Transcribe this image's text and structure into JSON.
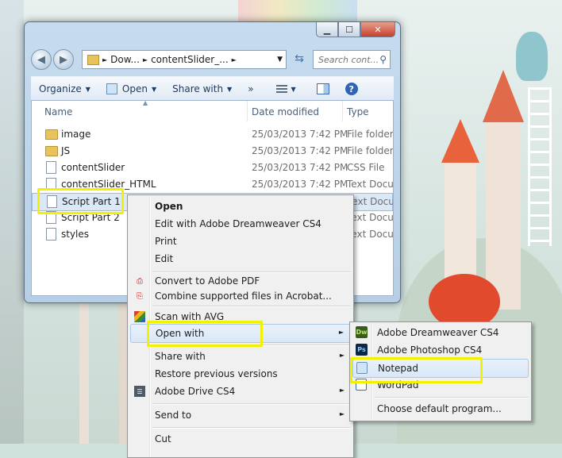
{
  "window": {
    "caption_min": "▁",
    "caption_max": "☐",
    "caption_close": "✕"
  },
  "address": {
    "segments": [
      "Dow...",
      "contentSlider_..."
    ],
    "separator": "►",
    "dropdown": "▼"
  },
  "search": {
    "placeholder": "Search cont..."
  },
  "toolbar": {
    "organize": "Organize",
    "open": "Open",
    "share_with": "Share with",
    "more": "»"
  },
  "columns": {
    "name": "Name",
    "date_modified": "Date modified",
    "type": "Type"
  },
  "files": [
    {
      "name": "image",
      "date": "25/03/2013 7:42 PM",
      "type": "File folder",
      "icon": "folder-icon"
    },
    {
      "name": "JS",
      "date": "25/03/2013 7:42 PM",
      "type": "File folder",
      "icon": "folder-icon"
    },
    {
      "name": "contentSlider",
      "date": "25/03/2013 7:42 PM",
      "type": "CSS File",
      "icon": "file-icon"
    },
    {
      "name": "contentSlider_HTML",
      "date": "25/03/2013 7:42 PM",
      "type": "Text Docum",
      "icon": "file-icon"
    },
    {
      "name": "Script Part 1",
      "date": "",
      "type": "Text Docum",
      "icon": "file-icon"
    },
    {
      "name": "Script Part 2",
      "date": "",
      "type": "Text Docum",
      "icon": "file-icon"
    },
    {
      "name": "styles",
      "date": "",
      "type": "Text Docum",
      "icon": "file-icon"
    }
  ],
  "context_menu": {
    "open": "Open",
    "edit_dreamweaver": "Edit with Adobe Dreamweaver CS4",
    "print": "Print",
    "edit": "Edit",
    "convert_pdf": "Convert to Adobe PDF",
    "combine_acrobat": "Combine supported files in Acrobat...",
    "scan_avg": "Scan with AVG",
    "open_with": "Open with",
    "share_with": "Share with",
    "restore_versions": "Restore previous versions",
    "adobe_drive": "Adobe Drive CS4",
    "send_to": "Send to",
    "cut": "Cut",
    "submenu_arrow": "►"
  },
  "open_with_menu": {
    "dreamweaver": "Adobe Dreamweaver CS4",
    "photoshop": "Adobe Photoshop CS4",
    "notepad": "Notepad",
    "wordpad": "WordPad",
    "choose_default": "Choose default program...",
    "dw_badge": "Dw",
    "ps_badge": "Ps"
  },
  "colors": {
    "highlight_yellow": "#f2f200",
    "menu_hover": "#d9e7f7",
    "folder": "#e8c25b"
  }
}
